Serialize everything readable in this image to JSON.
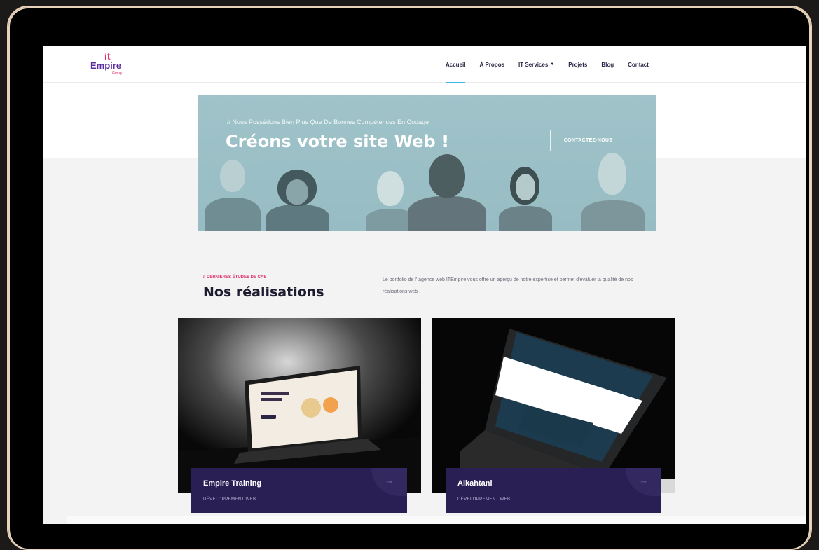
{
  "logo": {
    "it": "it",
    "empire": "Empire",
    "group": "Group"
  },
  "nav": {
    "items": [
      {
        "label": "Accueil"
      },
      {
        "label": "À Propos"
      },
      {
        "label": "IT Services"
      },
      {
        "label": "Projets"
      },
      {
        "label": "Blog"
      },
      {
        "label": "Contact"
      }
    ],
    "active": "Accueil",
    "caret": "▼"
  },
  "hero": {
    "subtitle": "// Nous Possédons Bien Plus Que De Bonnes Compétences En Codage",
    "title": "Créons votre site Web !",
    "button": "CONTACTEZ-NOUS"
  },
  "section": {
    "kicker": "// DERNIÈRES ÉTUDES DE CAS",
    "title": "Nos réalisations",
    "description": "Le portfolio de l' agence web ITEmpire vous offre un aperçu de notre expertise et permet d'évaluer la qualité de nos réalisations web ."
  },
  "cards": [
    {
      "title": "Empire Training",
      "category": "DÉVELOPPEMENT WEB",
      "arrow": "→"
    },
    {
      "title": "Alkahtani",
      "category": "DÉVELOPPEMENT WEB",
      "arrow": "→"
    }
  ],
  "colors": {
    "accent_pink": "#e2306c",
    "brand_purple": "#5b2ca0",
    "card_navy": "#2a1f55",
    "hero_teal": "#9fc3c9",
    "active_underline": "#3ab6e8"
  }
}
